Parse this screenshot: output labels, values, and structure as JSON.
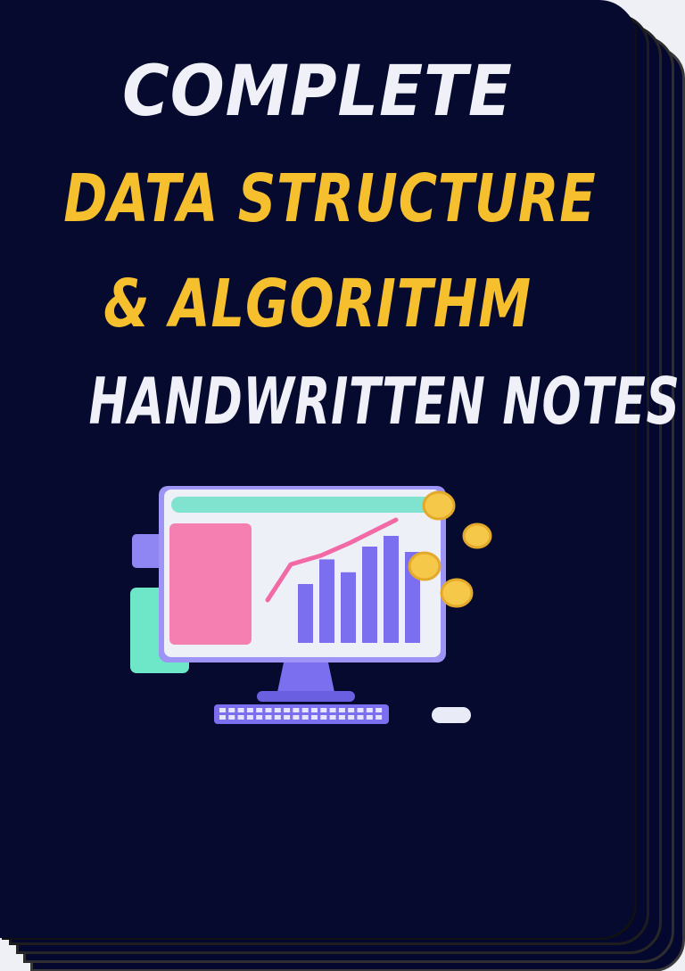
{
  "cover": {
    "title_line_1": "COMPLETE",
    "title_line_2": "DATA STRUCTURE",
    "title_line_3": "& ALGORITHM",
    "title_line_4": "HANDWRITTEN NOTES"
  },
  "illustration": {
    "subject": "computer-monitor-with-chart",
    "bar_levels": [
      0.55,
      0.78,
      0.66,
      0.9,
      1.0,
      0.85
    ]
  },
  "colors": {
    "background": "#050a2e",
    "title_white": "#f0f1f8",
    "title_yellow": "#f5bf2e",
    "screen": "#eef0f8",
    "accent_teal": "#6ee7c8",
    "accent_pink": "#f47fb0",
    "accent_purple": "#7b6ff0",
    "coin": "#f5c84a"
  }
}
